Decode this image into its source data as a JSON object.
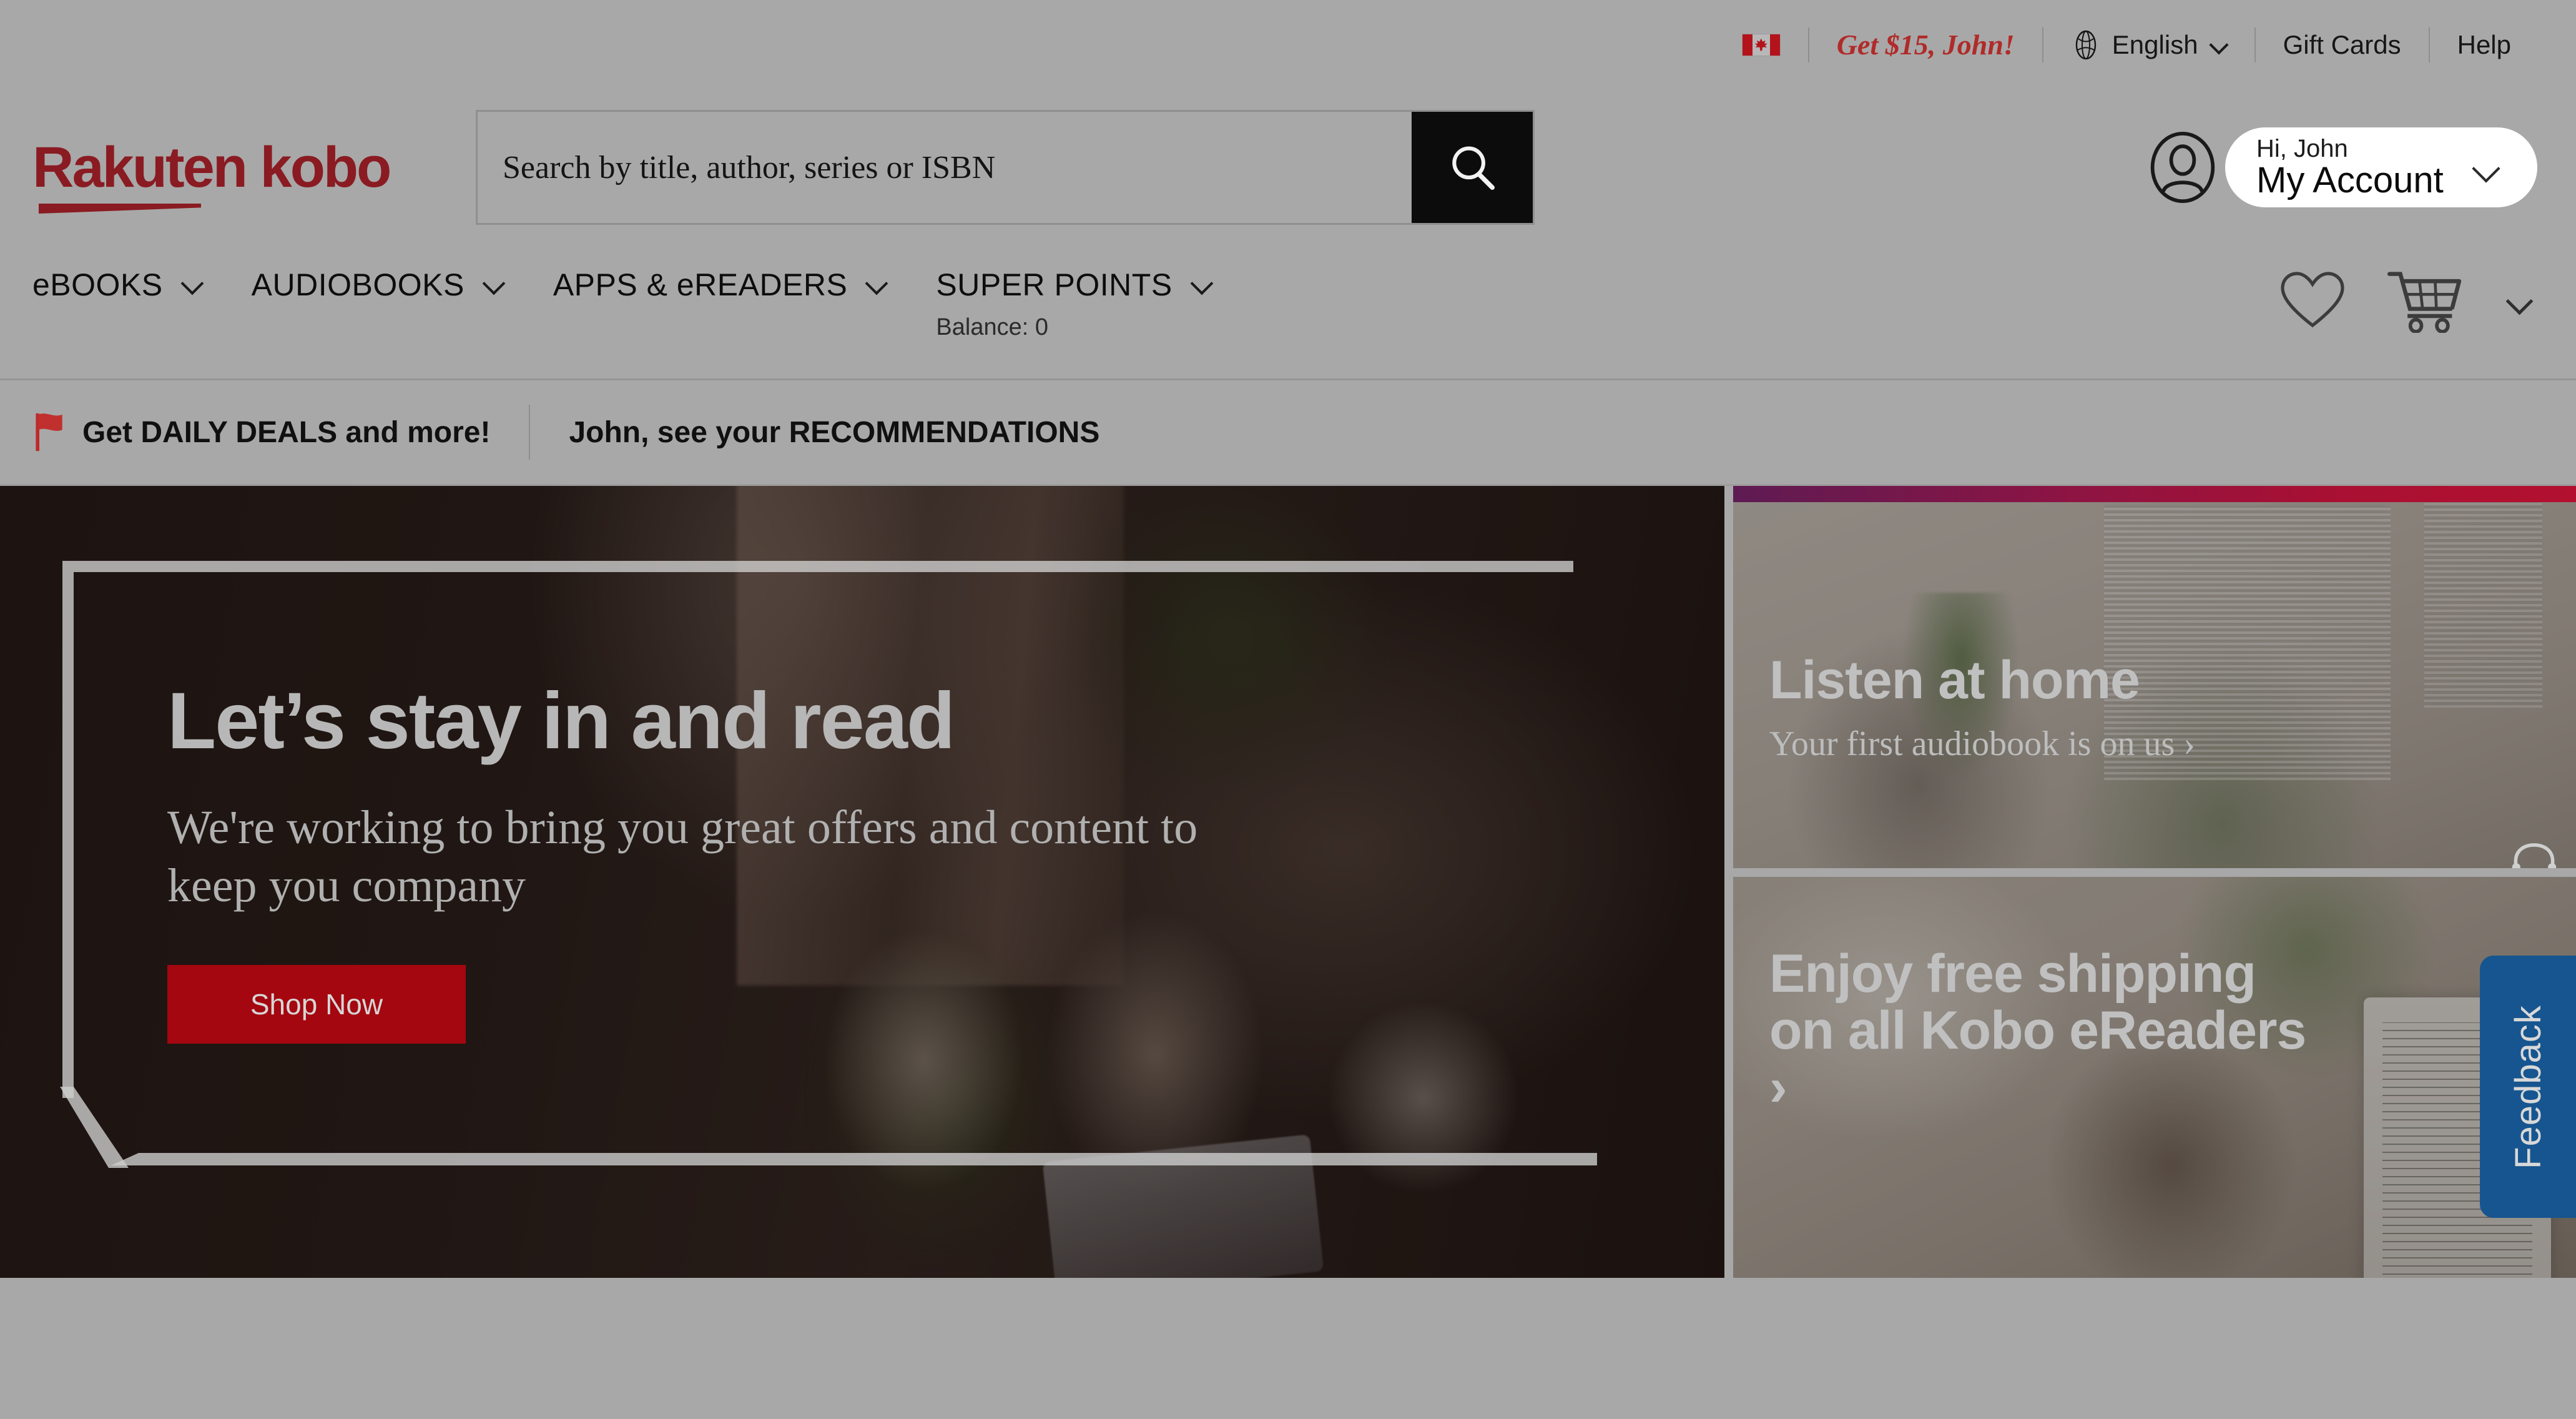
{
  "utility_bar": {
    "flag_icon": "canada-flag-icon",
    "promo_offer": "Get $15, John!",
    "globe_icon": "globe-icon",
    "language": "English",
    "language_chevron": "chevron-down-icon",
    "gift_cards": "Gift Cards",
    "help": "Help"
  },
  "masthead": {
    "logo_primary": "Rakuten",
    "logo_secondary": "kobo",
    "search": {
      "placeholder": "Search by title, author, series or ISBN",
      "value": "",
      "button_icon": "search-icon"
    },
    "account": {
      "avatar_icon": "user-avatar-icon",
      "greeting": "Hi, John",
      "label": "My Account",
      "chevron": "chevron-down-icon"
    }
  },
  "main_nav": {
    "items": [
      {
        "label": "eBOOKS",
        "sub": "",
        "chevron": "chevron-down-icon"
      },
      {
        "label": "AUDIOBOOKS",
        "sub": "",
        "chevron": "chevron-down-icon"
      },
      {
        "label": "APPS & eREADERS",
        "sub": "",
        "chevron": "chevron-down-icon"
      },
      {
        "label": "SUPER POINTS",
        "sub": "Balance: 0",
        "chevron": "chevron-down-icon"
      }
    ],
    "wishlist_icon": "heart-icon",
    "cart_icon": "shopping-cart-icon",
    "cart_chevron": "chevron-down-icon"
  },
  "promo_strip": {
    "flag_pin_icon": "red-flag-icon",
    "daily_deals": "Get DAILY DEALS and more!",
    "recommendations": "John, see your RECOMMENDATIONS"
  },
  "hero": {
    "title": "Let’s stay in and read",
    "subtitle": "We're working to bring you great offers and content to keep you company",
    "cta": "Shop Now"
  },
  "promo_cards": [
    {
      "title": "Listen at home",
      "subtitle": "Your first audiobook is on us ›",
      "accent": "#a81033",
      "headphones_icon": "headphones-icon"
    },
    {
      "title": "Enjoy free shipping on all Kobo eReaders ›",
      "subtitle": "",
      "accent": "#a81033"
    }
  ],
  "feedback_tab": {
    "label": "Feedback",
    "color": "#16558f"
  },
  "colors": {
    "page_background": "#a8a8a8",
    "brand_red": "#8a1b22",
    "cta_red": "#a4070f",
    "promo_red": "#b02b29",
    "text_dark": "#101010"
  }
}
